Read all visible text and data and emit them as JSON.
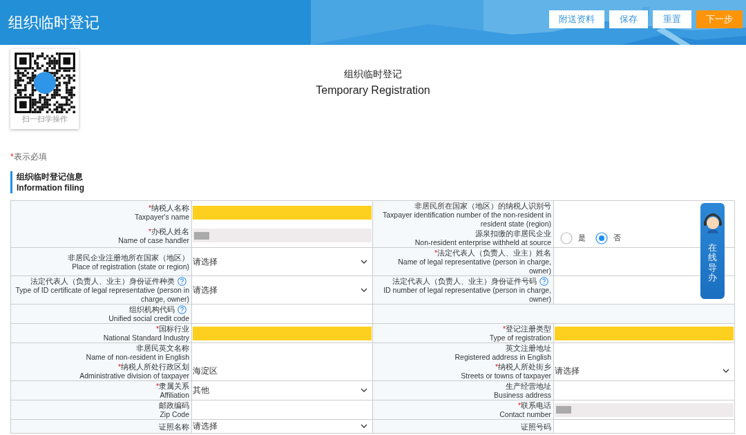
{
  "header": {
    "title": "组织临时登记",
    "buttons": [
      {
        "label": "附送资料",
        "primary": false
      },
      {
        "label": "保存",
        "primary": false
      },
      {
        "label": "重置",
        "primary": false
      },
      {
        "label": "下一步",
        "primary": true
      }
    ]
  },
  "qr": {
    "caption": "扫一扫学操作"
  },
  "page_title": {
    "zh": "组织临时登记",
    "en": "Temporary Registration"
  },
  "required_note": {
    "mark": "*",
    "text": "表示必填"
  },
  "section": {
    "title": "组织临时登记信息",
    "subtitle": "Information filing"
  },
  "form": {
    "rows": [
      {
        "left": {
          "kind": "fields",
          "entries": [
            {
              "label": {
                "mark": "*",
                "zh": "纳税人名称",
                "en": "Taxpayer's name"
              },
              "field": {
                "kind": "highlight"
              }
            },
            {
              "label": {
                "mark": "*",
                "zh": "办税人姓名",
                "en": "Name of case handler"
              },
              "field": {
                "kind": "blurred"
              }
            }
          ]
        },
        "right": {
          "kind": "fields",
          "entries": [
            {
              "label": {
                "zh": "非居民所在国家（地区）的纳税人识别号",
                "en": "Taxpayer identification number of the non-resident in resident state (region)"
              },
              "field": {
                "kind": "text"
              }
            },
            {
              "label": {
                "zh": "源泉扣缴的非居民企业",
                "en": "Non-resident enterprise withheld at source"
              },
              "field": {
                "kind": "radio",
                "options": [
                  {
                    "label": "是",
                    "selected": false
                  },
                  {
                    "label": "否",
                    "selected": true
                  }
                ]
              }
            }
          ]
        }
      },
      {
        "left": {
          "kind": "fields",
          "entries": [
            {
              "label": {
                "zh": "非居民企业注册地所在国家（地区）",
                "en": "Place of registration (state or region)"
              },
              "field": {
                "kind": "select",
                "value": "请选择"
              }
            }
          ]
        },
        "right": {
          "kind": "fields",
          "entries": [
            {
              "label": {
                "mark": "*",
                "zh": "法定代表人（负责人、业主）姓名",
                "en": "Name of legal representative (person in charge, owner)"
              },
              "field": {
                "kind": "text"
              }
            }
          ]
        }
      },
      {
        "left": {
          "kind": "fields",
          "entries": [
            {
              "label": {
                "zh": "法定代表人（负责人、业主）身份证件种类",
                "help": true,
                "en": "Type of ID certificate of legal representative (person in charge, owner)"
              },
              "field": {
                "kind": "select",
                "value": "请选择"
              }
            }
          ]
        },
        "right": {
          "kind": "fields",
          "entries": [
            {
              "label": {
                "zh": "法定代表人（负责人、业主）身份证件号码",
                "help": true,
                "en": "ID number of legal representative (person in charge, owner)"
              },
              "field": {
                "kind": "text"
              }
            }
          ]
        }
      },
      {
        "left": {
          "kind": "fields",
          "entries": [
            {
              "label": {
                "zh": "组织机构代码",
                "help": true,
                "en": "Unified social credit code"
              },
              "field": {
                "kind": "text"
              }
            }
          ]
        },
        "right": {
          "kind": "blank"
        }
      },
      {
        "left": {
          "kind": "fields",
          "entries": [
            {
              "label": {
                "mark": "*",
                "zh": "国标行业",
                "en": "National Standard Industry"
              },
              "field": {
                "kind": "highlight"
              }
            }
          ]
        },
        "right": {
          "kind": "fields",
          "entries": [
            {
              "label": {
                "mark": "*",
                "zh": "登记注册类型",
                "en": "Type of registration"
              },
              "field": {
                "kind": "highlight"
              }
            }
          ]
        }
      },
      {
        "left": {
          "kind": "fields",
          "entries": [
            {
              "label": {
                "zh": "非居民英文名称",
                "en": "Name of non-resident in English"
              },
              "field": {
                "kind": "text"
              }
            },
            {
              "label": {
                "mark": "*",
                "zh": "纳税人所处行政区划",
                "en": "Administrative division of taxpayer"
              },
              "field": {
                "kind": "text",
                "value": "海淀区"
              }
            }
          ]
        },
        "right": {
          "kind": "fields",
          "entries": [
            {
              "label": {
                "zh": "英文注册地址",
                "en": "Registered address in English"
              },
              "field": {
                "kind": "text"
              }
            },
            {
              "label": {
                "mark": "*",
                "zh": "纳税人所处街乡",
                "en": "Streets or towns of taxpayer"
              },
              "field": {
                "kind": "select",
                "value": "请选择"
              }
            }
          ]
        }
      },
      {
        "left": {
          "kind": "fields",
          "entries": [
            {
              "label": {
                "mark": "*",
                "zh": "隶属关系",
                "en": "Affiliation"
              },
              "field": {
                "kind": "select",
                "value": "其他"
              }
            }
          ]
        },
        "right": {
          "kind": "fields",
          "entries": [
            {
              "label": {
                "zh": "生产经营地址",
                "en": "Business address"
              },
              "field": {
                "kind": "text"
              }
            }
          ]
        }
      },
      {
        "left": {
          "kind": "fields",
          "entries": [
            {
              "label": {
                "zh": "邮政编码",
                "en": "Zip Code"
              },
              "field": {
                "kind": "text"
              }
            }
          ]
        },
        "right": {
          "kind": "fields",
          "entries": [
            {
              "label": {
                "mark": "*",
                "zh": "联系电话",
                "en": "Contact number"
              },
              "field": {
                "kind": "blurred"
              }
            }
          ]
        }
      },
      {
        "left": {
          "kind": "fields",
          "entries": [
            {
              "label": {
                "zh": "证照名称"
              },
              "field": {
                "kind": "select",
                "value": "请选择"
              }
            }
          ]
        },
        "right": {
          "kind": "fields",
          "entries": [
            {
              "label": {
                "zh": "证照号码"
              },
              "field": {
                "kind": "text"
              }
            }
          ]
        }
      }
    ]
  },
  "guide": {
    "label": "在线导办"
  }
}
